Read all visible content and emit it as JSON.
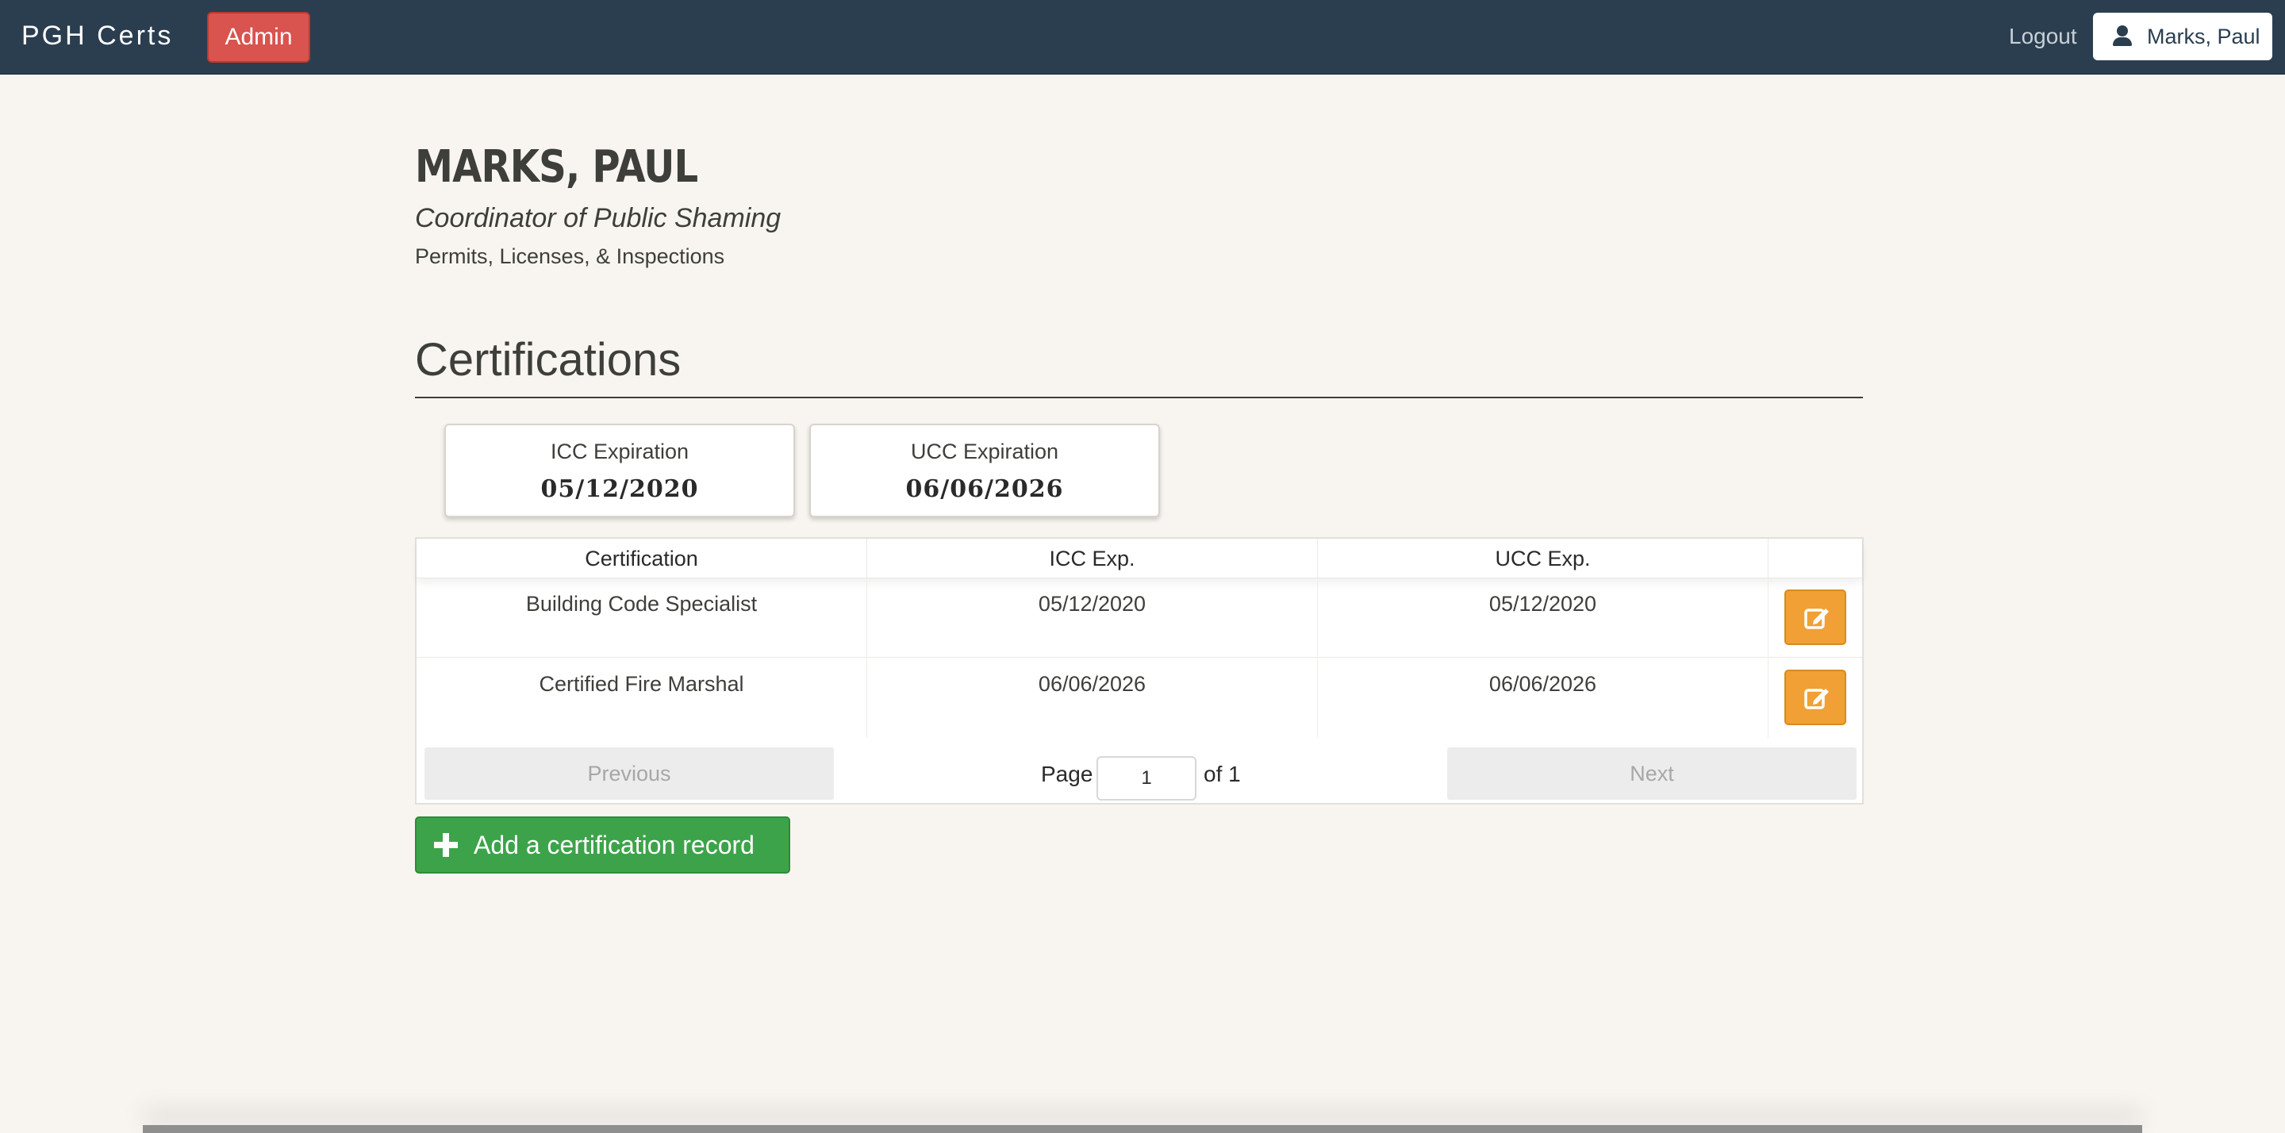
{
  "navbar": {
    "brand": "PGH Certs",
    "admin_label": "Admin",
    "logout_label": "Logout",
    "user_label": "Marks, Paul",
    "user_icon": "user-icon",
    "colors": {
      "background": "#2b3e50",
      "admin": "#d9534f"
    }
  },
  "profile": {
    "name": "MARKS, PAUL",
    "title": "Coordinator of Public Shaming",
    "department": "Permits, Licenses, & Inspections"
  },
  "certifications": {
    "heading": "Certifications",
    "summary": [
      {
        "label": "ICC Expiration",
        "value": "05/12/2020"
      },
      {
        "label": "UCC Expiration",
        "value": "06/06/2026"
      }
    ],
    "table": {
      "columns": [
        "Certification",
        "ICC Exp.",
        "UCC Exp.",
        ""
      ],
      "rows": [
        {
          "certification": "Building Code Specialist",
          "icc_exp": "05/12/2020",
          "ucc_exp": "05/12/2020",
          "action_icon": "edit-icon"
        },
        {
          "certification": "Certified Fire Marshal",
          "icc_exp": "06/06/2026",
          "ucc_exp": "06/06/2026",
          "action_icon": "edit-icon"
        }
      ]
    },
    "pagination": {
      "previous_label": "Previous",
      "page_label": "Page",
      "current_page": "1",
      "of_label": "of 1",
      "next_label": "Next"
    },
    "add_button_label": "Add a certification record",
    "add_button_icon": "plus-icon",
    "colors": {
      "edit": "#f0a035",
      "add": "#3da34a"
    }
  }
}
